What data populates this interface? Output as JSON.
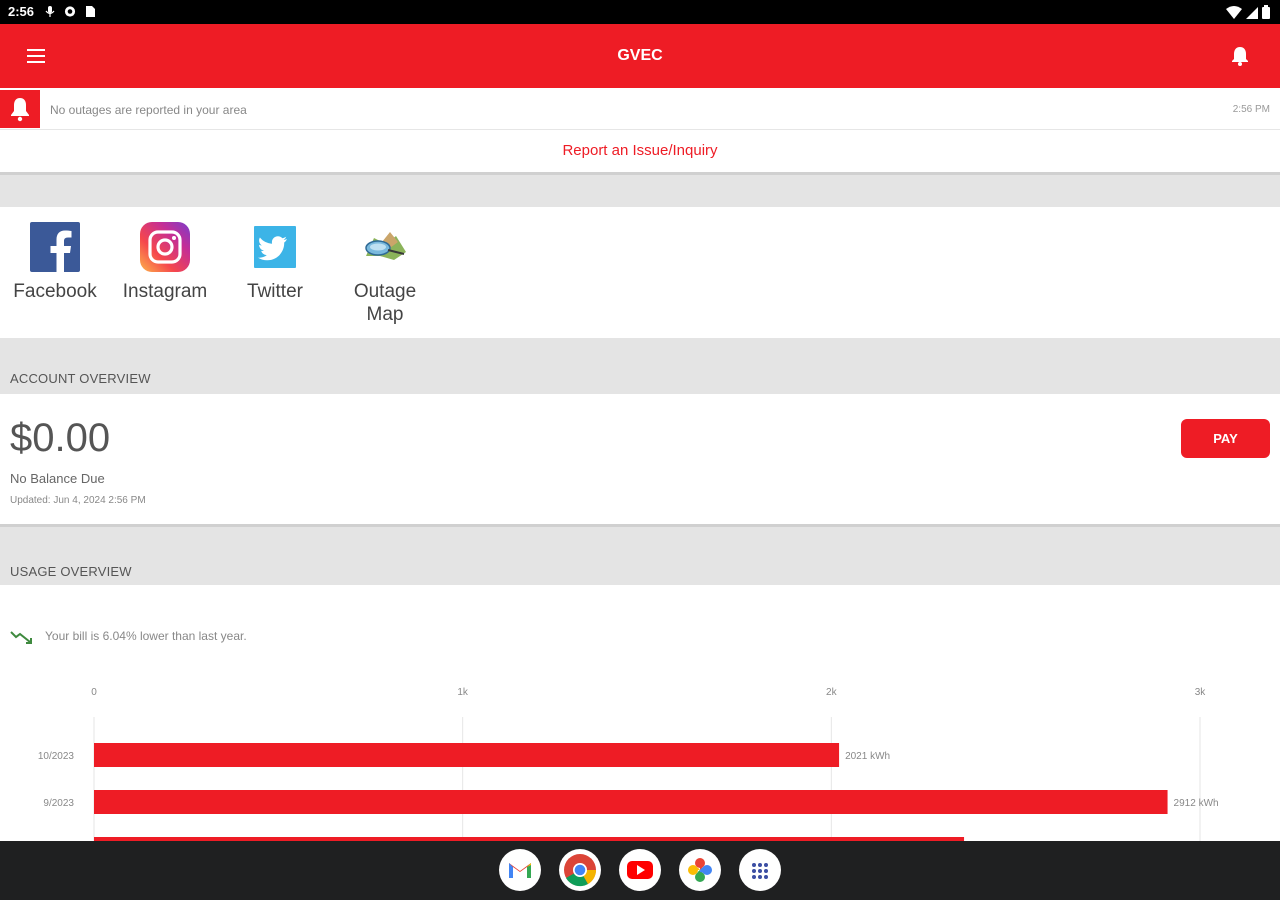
{
  "status_bar": {
    "time": "2:56"
  },
  "app_bar": {
    "title": "GVEC"
  },
  "outage": {
    "message": "No outages are reported in your area",
    "time": "2:56 PM"
  },
  "report_link": "Report an Issue/Inquiry",
  "social": [
    {
      "label": "Facebook",
      "icon": "facebook-icon"
    },
    {
      "label": "Instagram",
      "icon": "instagram-icon"
    },
    {
      "label": "Twitter",
      "icon": "twitter-icon"
    },
    {
      "label_line1": "Outage",
      "label_line2": "Map",
      "icon": "outage-map-icon"
    }
  ],
  "account": {
    "section_title": "ACCOUNT OVERVIEW",
    "amount": "$0.00",
    "balance_status": "No Balance Due",
    "updated": "Updated: Jun 4, 2024 2:56 PM",
    "pay_label": "PAY"
  },
  "usage": {
    "section_title": "USAGE OVERVIEW",
    "trend_text": "Your bill is 6.04% lower than last year."
  },
  "colors": {
    "brand_red": "#ee1c25",
    "nav_dark": "#1f2021"
  },
  "chart_data": {
    "type": "bar",
    "orientation": "horizontal",
    "axis_ticks": [
      "0",
      "1k",
      "2k",
      "3k"
    ],
    "xlim": [
      0,
      3000
    ],
    "categories": [
      "10/2023",
      "9/2023",
      ""
    ],
    "values": [
      2021,
      2912,
      2360
    ],
    "value_labels": [
      "2021 kWh",
      "2912 kWh",
      ""
    ],
    "grid": true
  },
  "dock": [
    "gmail-app-icon",
    "chrome-app-icon",
    "youtube-app-icon",
    "photos-app-icon",
    "app-drawer-icon"
  ]
}
